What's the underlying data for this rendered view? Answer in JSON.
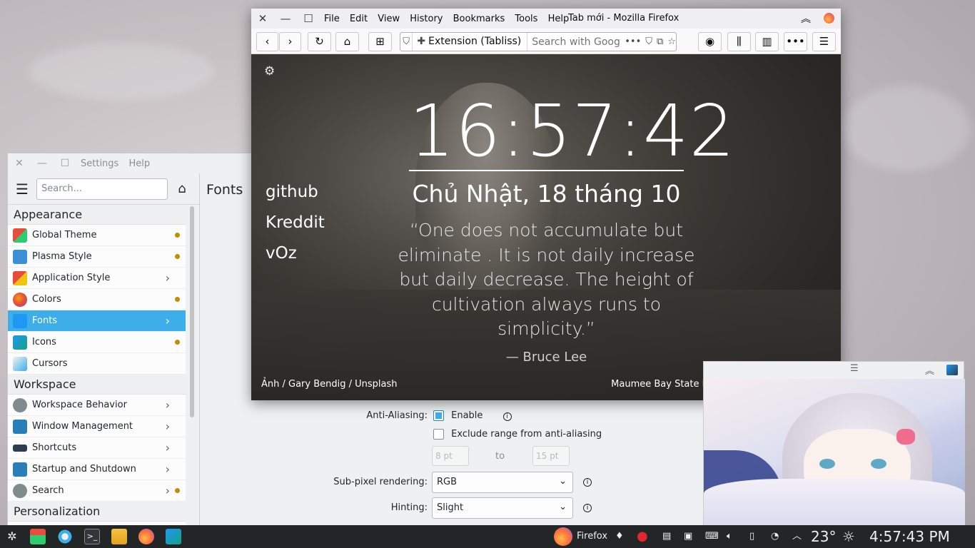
{
  "settings": {
    "menu": [
      "Settings",
      "Help"
    ],
    "search_placeholder": "Search...",
    "page_title": "Fonts",
    "categories": [
      {
        "label": "Appearance",
        "items": [
          {
            "label": "Global Theme",
            "icon": "global-theme-icon",
            "indicator": "dot"
          },
          {
            "label": "Plasma Style",
            "icon": "plasma-style-icon",
            "indicator": "dot"
          },
          {
            "label": "Application Style",
            "icon": "application-style-icon",
            "indicator": "chevron"
          },
          {
            "label": "Colors",
            "icon": "colors-icon",
            "indicator": "dot"
          },
          {
            "label": "Fonts",
            "icon": "fonts-icon",
            "indicator": "chevron",
            "selected": true
          },
          {
            "label": "Icons",
            "icon": "icons-icon",
            "indicator": "dot"
          },
          {
            "label": "Cursors",
            "icon": "cursors-icon",
            "indicator": ""
          }
        ]
      },
      {
        "label": "Workspace",
        "items": [
          {
            "label": "Workspace Behavior",
            "icon": "workspace-behavior-icon",
            "indicator": "chevron"
          },
          {
            "label": "Window Management",
            "icon": "window-management-icon",
            "indicator": "chevron"
          },
          {
            "label": "Shortcuts",
            "icon": "shortcuts-icon",
            "indicator": "chevron"
          },
          {
            "label": "Startup and Shutdown",
            "icon": "startup-shutdown-icon",
            "indicator": "chevron"
          },
          {
            "label": "Search",
            "icon": "search-module-icon",
            "indicator": "chevron-dot"
          }
        ]
      },
      {
        "label": "Personalization",
        "items": []
      }
    ],
    "fonts_form": {
      "anti_aliasing_label": "Anti-Aliasing:",
      "enable_label": "Enable",
      "exclude_label": "Exclude range from anti-aliasing",
      "range_from": "8 pt",
      "range_to_label": "to",
      "range_to": "15 pt",
      "subpixel_label": "Sub-pixel rendering:",
      "subpixel_value": "RGB",
      "hinting_label": "Hinting:",
      "hinting_value": "Slight"
    }
  },
  "firefox": {
    "menu": [
      "File",
      "Edit",
      "View",
      "History",
      "Bookmarks",
      "Tools",
      "Help"
    ],
    "window_title": "Tab mới - Mozilla Firefox",
    "url_identity": "Extension (Tabliss)",
    "search_placeholder": "Search with Google",
    "tabliss": {
      "time": "16:57:42",
      "date": "Chủ Nhật, 18 tháng 10",
      "links": [
        "github",
        "Kreddit",
        "vOz"
      ],
      "quote": "“One does not accumulate but eliminate . It is not daily increase but daily decrease. The height of cultivation always runs to simplicity.”",
      "author": "— Bruce Lee",
      "photo_credit": "Ảnh / Gary Bendig / Unsplash",
      "location": "Maumee Bay State Park, Oregon, United States"
    }
  },
  "taskbar": {
    "firefox_label": "Firefox",
    "temperature": "23°",
    "clock": "4:57:43 PM"
  },
  "colors": {
    "selection": "#3daee9",
    "indicator_dot": "#c68c00",
    "taskbar_bg": "#232627"
  }
}
